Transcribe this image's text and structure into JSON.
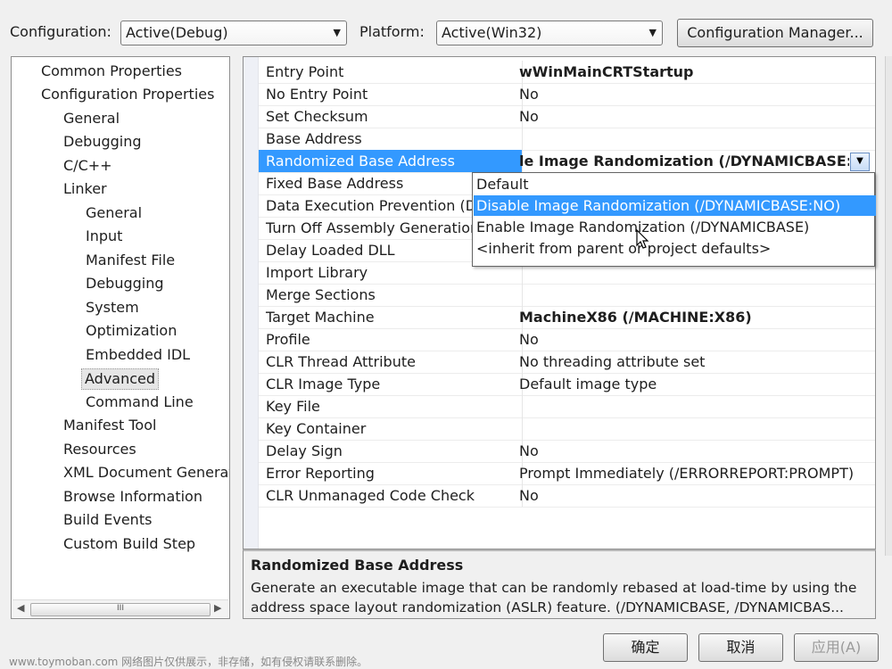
{
  "toolbar": {
    "configuration_label": "Configuration:",
    "configuration_value": "Active(Debug)",
    "platform_label": "Platform:",
    "platform_value": "Active(Win32)",
    "config_manager_label": "Configuration Manager..."
  },
  "tree": {
    "items": [
      {
        "label": "Common Properties"
      },
      {
        "label": "Configuration Properties"
      },
      {
        "label": "General"
      },
      {
        "label": "Debugging"
      },
      {
        "label": "C/C++"
      },
      {
        "label": "Linker"
      },
      {
        "label": "General"
      },
      {
        "label": "Input"
      },
      {
        "label": "Manifest File"
      },
      {
        "label": "Debugging"
      },
      {
        "label": "System"
      },
      {
        "label": "Optimization"
      },
      {
        "label": "Embedded IDL"
      },
      {
        "label": "Advanced"
      },
      {
        "label": "Command Line"
      },
      {
        "label": "Manifest Tool"
      },
      {
        "label": "Resources"
      },
      {
        "label": "XML Document Generat"
      },
      {
        "label": "Browse Information"
      },
      {
        "label": "Build Events"
      },
      {
        "label": "Custom Build Step"
      }
    ],
    "scroll_thumb_glyph": "III"
  },
  "grid": {
    "rows": [
      {
        "name": "Entry Point",
        "value": "wWinMainCRTStartup"
      },
      {
        "name": "No Entry Point",
        "value": "No"
      },
      {
        "name": "Set Checksum",
        "value": "No"
      },
      {
        "name": "Base Address",
        "value": ""
      },
      {
        "name": "Randomized Base Address",
        "value": "le Image Randomization (/DYNAMICBASE:NO)"
      },
      {
        "name": "Fixed Base Address",
        "value": ""
      },
      {
        "name": "Data Execution Prevention (DE",
        "value": ""
      },
      {
        "name": "Turn Off Assembly Generation",
        "value": ""
      },
      {
        "name": "Delay Loaded DLL",
        "value": ""
      },
      {
        "name": "Import Library",
        "value": ""
      },
      {
        "name": "Merge Sections",
        "value": ""
      },
      {
        "name": "Target Machine",
        "value": "MachineX86 (/MACHINE:X86)"
      },
      {
        "name": "Profile",
        "value": "No"
      },
      {
        "name": "CLR Thread Attribute",
        "value": "No threading attribute set"
      },
      {
        "name": "CLR Image Type",
        "value": "Default image type"
      },
      {
        "name": "Key File",
        "value": ""
      },
      {
        "name": "Key Container",
        "value": ""
      },
      {
        "name": "Delay Sign",
        "value": "No"
      },
      {
        "name": "Error Reporting",
        "value": "Prompt Immediately (/ERRORREPORT:PROMPT)"
      },
      {
        "name": "CLR Unmanaged Code Check",
        "value": "No"
      }
    ]
  },
  "dropdown": {
    "options": [
      {
        "label": "Default"
      },
      {
        "label": "Disable Image Randomization (/DYNAMICBASE:NO)"
      },
      {
        "label": "Enable Image Randomization (/DYNAMICBASE)"
      },
      {
        "label": "<inherit from parent or project defaults>"
      }
    ]
  },
  "description": {
    "title": "Randomized Base Address",
    "text": "Generate an executable image that can be randomly rebased at load-time by using the address space layout randomization (ASLR) feature.      (/DYNAMICBASE, /DYNAMICBAS..."
  },
  "buttons": {
    "ok": "确定",
    "cancel": "取消",
    "apply": "应用(A)"
  },
  "watermark": "www.toymoban.com 网络图片仅供展示，非存储，如有侵权请联系删除。",
  "colors": {
    "selection": "#3399ff",
    "window_bg": "#f0f0f0"
  }
}
